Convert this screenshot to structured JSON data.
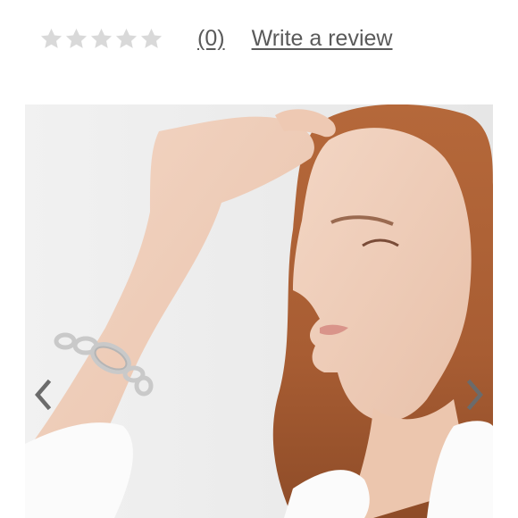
{
  "rating": {
    "stars_filled": 0,
    "stars_total": 5,
    "count_label": "(0)",
    "write_review_label": "Write a review",
    "star_color_empty": "#d9d9d9",
    "link_color": "#5a5a5a"
  },
  "carousel": {
    "image_icon": "model-wearing-silver-link-bracelet-photo",
    "prev_icon": "chevron-left-icon",
    "next_icon": "chevron-right-icon",
    "arrow_color": "#6b6b6b"
  }
}
